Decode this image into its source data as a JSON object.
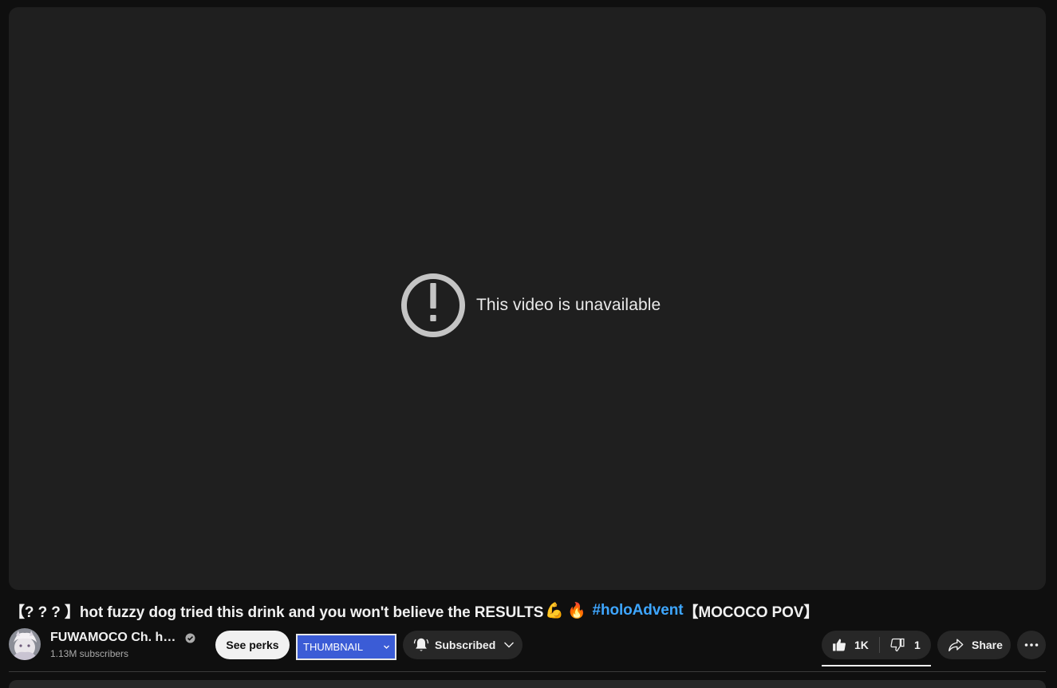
{
  "player": {
    "error_message": "This video is unavailable",
    "error_icon": "exclamation-circle-icon"
  },
  "video": {
    "title_prefix": "【? ? ? 】hot fuzzy dog tried this drink and you won't believe the RESULTS",
    "title_emoji_1": "💪",
    "title_emoji_2": "🔥",
    "title_hashtag": "#holoAdvent",
    "title_suffix": "【MOCOCO POV】"
  },
  "owner": {
    "channel_name": "FUWAMOCO Ch. hololive-EN",
    "subscriber_count": "1.13M subscribers",
    "verified_icon": "verified-check-icon"
  },
  "actions": {
    "perks_label": "See perks",
    "thumbnail_select_value": "THUMBNAIL",
    "subscribed_label": "Subscribed",
    "like_count": "1K",
    "dislike_count": "1",
    "share_label": "Share"
  },
  "colors": {
    "background": "#0f0f0f",
    "player": "#1f1f1f",
    "button_bg": "#272727",
    "hashtag": "#3ea6ff",
    "select_bg": "#3b5cd6"
  }
}
